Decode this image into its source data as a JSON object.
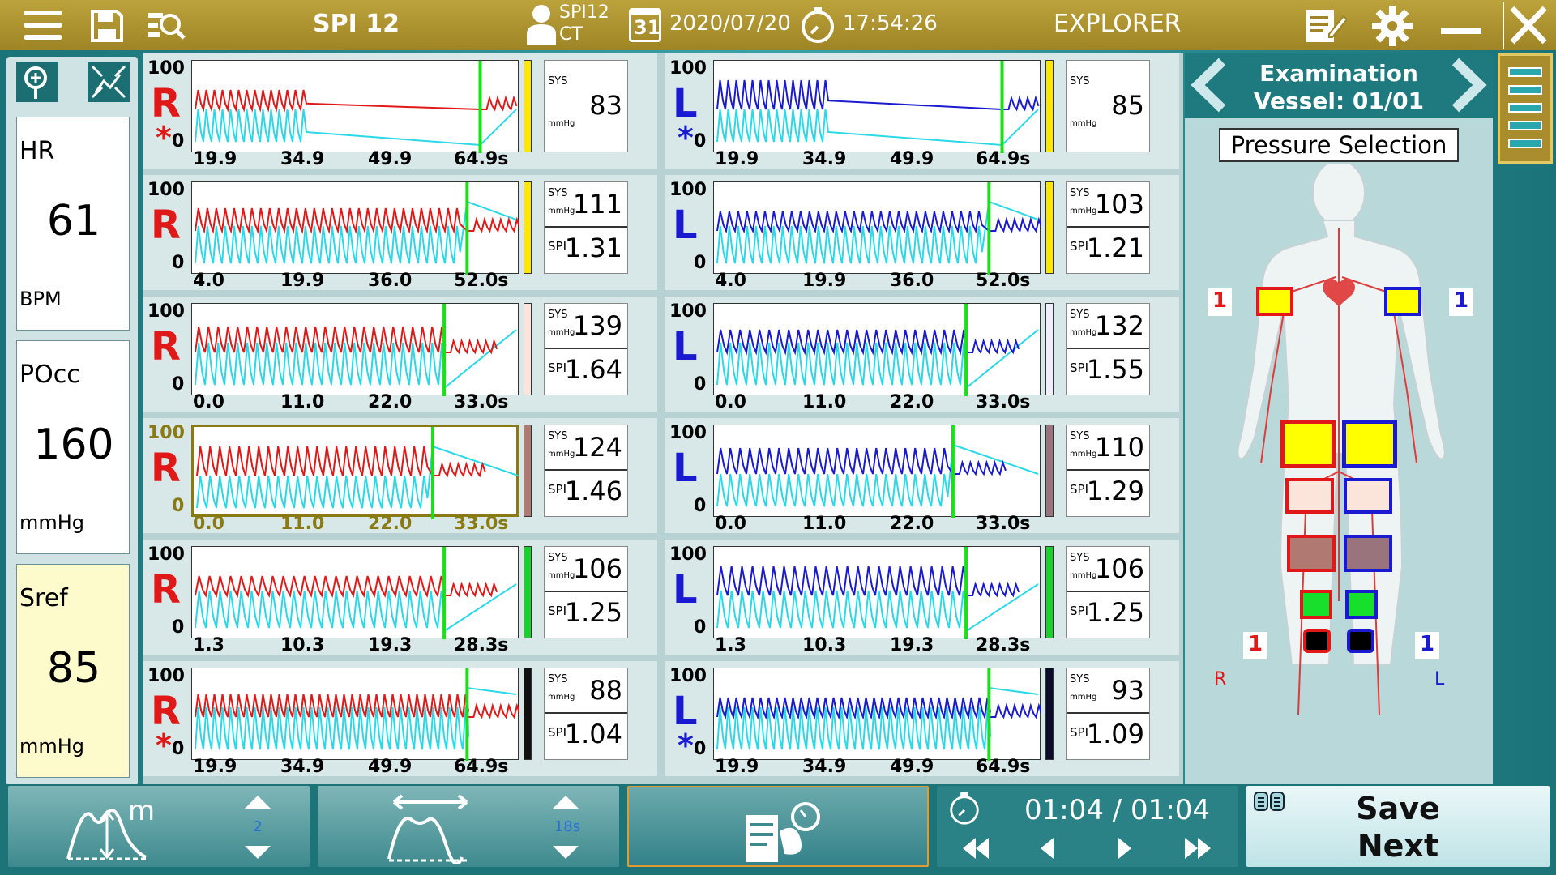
{
  "header": {
    "device": "SPI 12",
    "patient_line1": "SPI12",
    "patient_line2": "CT",
    "calendar_day": "31",
    "date": "2020/07/20",
    "time": "17:54:26",
    "mode": "EXPLORER"
  },
  "vitals": {
    "hr": {
      "label": "HR",
      "value": "61",
      "unit": "BPM"
    },
    "pocc": {
      "label": "POcc",
      "value": "160",
      "unit": "mmHg"
    },
    "sref": {
      "label": "Sref",
      "value": "85",
      "unit": "mmHg"
    }
  },
  "plots": {
    "left": [
      {
        "side": "R",
        "star": true,
        "ytop": "100",
        "ybot": "0",
        "x": [
          "19.9",
          "34.9",
          "49.9",
          "64.9s"
        ],
        "sys": "83",
        "spi": null,
        "indicator": "#ffe600"
      },
      {
        "side": "R",
        "star": false,
        "ytop": "100",
        "ybot": "0",
        "x": [
          "4.0",
          "19.9",
          "36.0",
          "52.0s"
        ],
        "sys": "111",
        "spi": "1.31",
        "indicator": "#ffe600"
      },
      {
        "side": "R",
        "star": false,
        "ytop": "100",
        "ybot": "0",
        "x": [
          "0.0",
          "11.0",
          "22.0",
          "33.0s"
        ],
        "sys": "139",
        "spi": "1.64",
        "indicator": "#fbe5da"
      },
      {
        "side": "R",
        "star": false,
        "ytop": "100",
        "ybot": "0",
        "x": [
          "0.0",
          "11.0",
          "22.0",
          "33.0s"
        ],
        "sys": "124",
        "spi": "1.46",
        "indicator": "#b07a72",
        "selected": true
      },
      {
        "side": "R",
        "star": false,
        "ytop": "100",
        "ybot": "0",
        "x": [
          "1.3",
          "10.3",
          "19.3",
          "28.3s"
        ],
        "sys": "106",
        "spi": "1.25",
        "indicator": "#16d22b"
      },
      {
        "side": "R",
        "star": true,
        "ytop": "100",
        "ybot": "0",
        "x": [
          "19.9",
          "34.9",
          "49.9",
          "64.9s"
        ],
        "sys": "88",
        "spi": "1.04",
        "indicator": "#111111"
      }
    ],
    "right": [
      {
        "side": "L",
        "star": true,
        "ytop": "100",
        "ybot": "0",
        "x": [
          "19.9",
          "34.9",
          "49.9",
          "64.9s"
        ],
        "sys": "85",
        "spi": null,
        "indicator": "#ffe600"
      },
      {
        "side": "L",
        "star": false,
        "ytop": "100",
        "ybot": "0",
        "x": [
          "4.0",
          "19.9",
          "36.0",
          "52.0s"
        ],
        "sys": "103",
        "spi": "1.21",
        "indicator": "#ffe600"
      },
      {
        "side": "L",
        "star": false,
        "ytop": "100",
        "ybot": "0",
        "x": [
          "0.0",
          "11.0",
          "22.0",
          "33.0s"
        ],
        "sys": "132",
        "spi": "1.55",
        "indicator": "#eeeeff"
      },
      {
        "side": "L",
        "star": false,
        "ytop": "100",
        "ybot": "0",
        "x": [
          "0.0",
          "11.0",
          "22.0",
          "33.0s"
        ],
        "sys": "110",
        "spi": "1.29",
        "indicator": "#9a747c"
      },
      {
        "side": "L",
        "star": false,
        "ytop": "100",
        "ybot": "0",
        "x": [
          "1.3",
          "10.3",
          "19.3",
          "28.3s"
        ],
        "sys": "106",
        "spi": "1.25",
        "indicator": "#16d22b"
      },
      {
        "side": "L",
        "star": true,
        "ytop": "100",
        "ybot": "0",
        "x": [
          "19.9",
          "34.9",
          "49.9",
          "64.9s"
        ],
        "sys": "93",
        "spi": "1.09",
        "indicator": "#0a0a2a"
      }
    ],
    "sys_label": "SYS",
    "mmhg_label": "mmHg",
    "spi_label": "SPI"
  },
  "examination": {
    "title": "Examination",
    "vessel": "Vessel: 01/01",
    "pressure_selection": "Pressure Selection",
    "arm_right_count": "1",
    "arm_left_count": "1",
    "ankle_right_count": "1",
    "ankle_left_count": "1",
    "side_r": "R",
    "side_l": "L"
  },
  "footer": {
    "amplitude_value": "2",
    "timebase_value": "18s",
    "playback_position": "01:04 / 01:04",
    "save_label": "Save",
    "next_label": "Next"
  },
  "colors": {
    "header": "#a98c2c",
    "right_trace": "#e01818",
    "left_trace": "#1a1ad0",
    "cuff_trace": "#2ad8e8",
    "marker": "#19e019",
    "accent_orange": "#e09c33"
  }
}
